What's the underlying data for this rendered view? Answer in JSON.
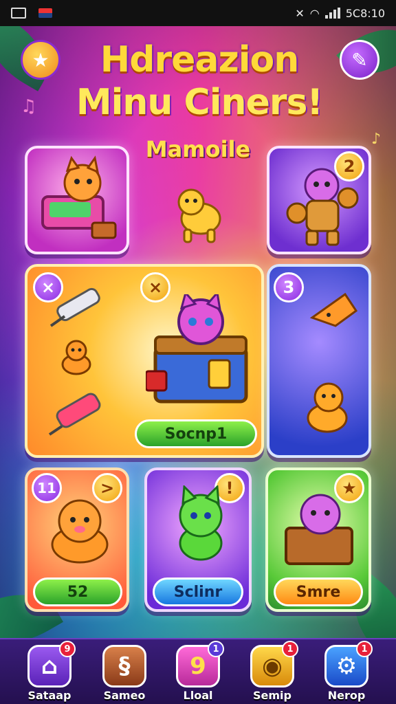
{
  "status_bar": {
    "time": "5C8:10"
  },
  "header": {
    "title_line1": "Hdreazion",
    "title_line2": "Minu Ciners!",
    "subtitle": "Mamoile",
    "heart_icon": "heart-star-icon",
    "settings_icon": "wrench-icon"
  },
  "cards": {
    "top_left": {
      "icon": "cat-with-box"
    },
    "top_right": {
      "badge": "2",
      "icon": "cat-boxer"
    },
    "featured": {
      "badge_left": "×",
      "badge_right": "×",
      "button": "Socnp1"
    },
    "side": {
      "badge": "3"
    },
    "bottom_left": {
      "badge_left": "11",
      "badge_right": ">",
      "button": "52"
    },
    "bottom_middle": {
      "badge": "!",
      "button": "Sclinr"
    },
    "bottom_right": {
      "badge": "★",
      "button": "Smre"
    }
  },
  "bottom_nav": [
    {
      "label": "Sataap",
      "icon": "home-icon",
      "badge": "9",
      "color": "#7a3bd8"
    },
    {
      "label": "Sameo",
      "icon": "sword-swap-icon",
      "badge": "",
      "color": "#a9542a"
    },
    {
      "label": "Lloal",
      "icon": "nine-icon",
      "badge": "1",
      "color": "#e23fbf"
    },
    {
      "label": "Semip",
      "icon": "coin-icon",
      "badge": "1",
      "color": "#e2a51c"
    },
    {
      "label": "Nerop",
      "icon": "gear-icon",
      "badge": "1",
      "color": "#1f6fd8"
    }
  ]
}
